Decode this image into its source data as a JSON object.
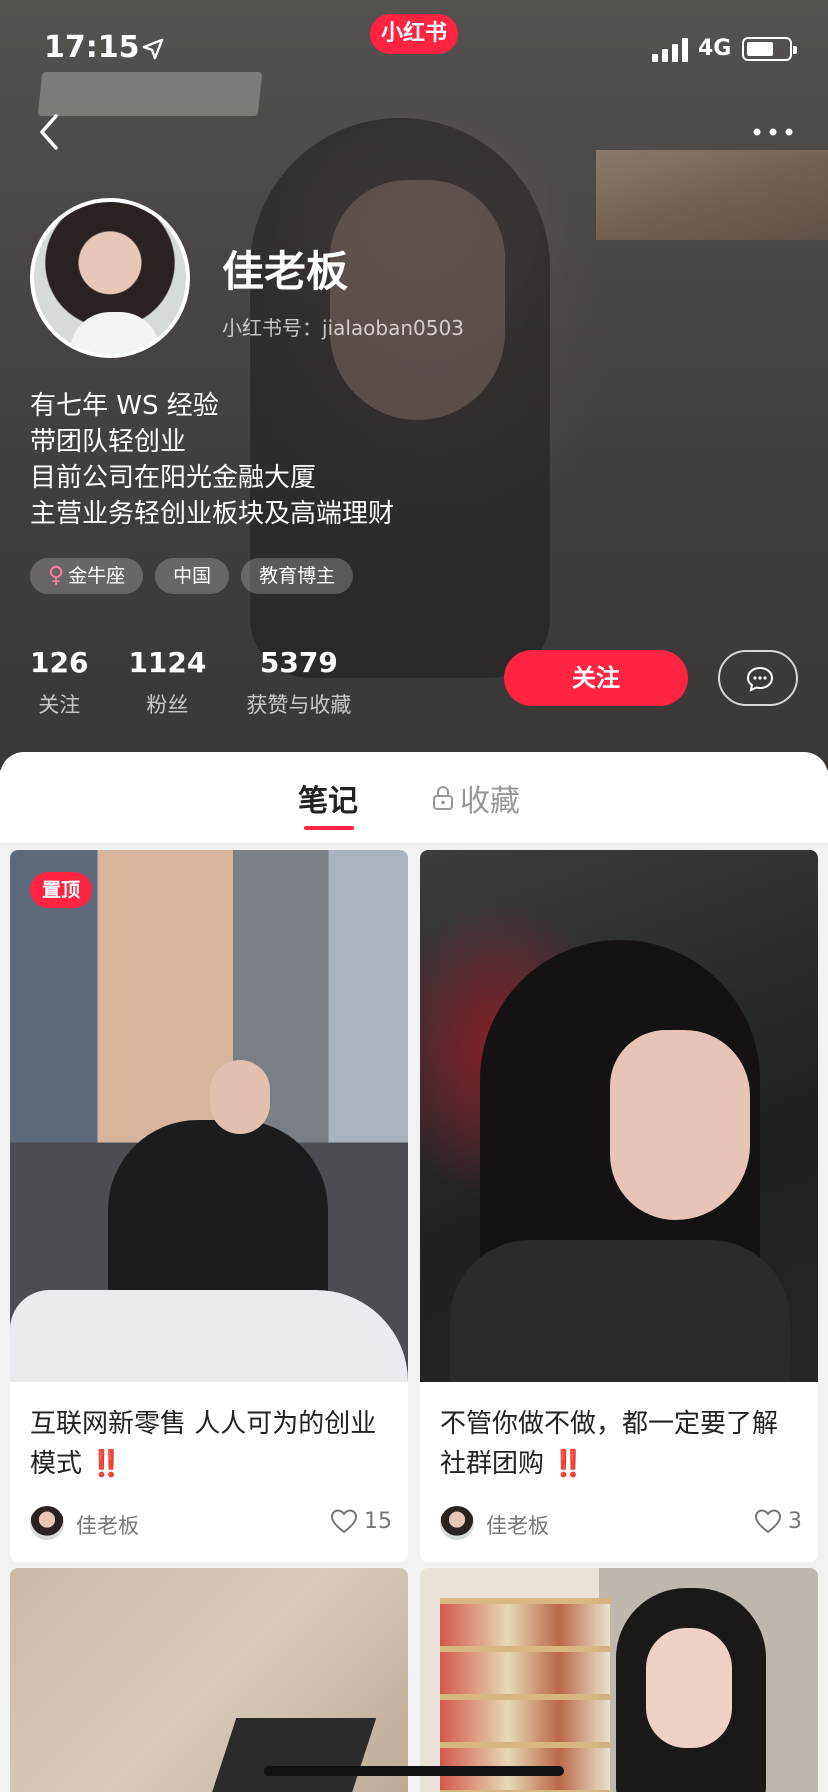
{
  "status_bar": {
    "time": "17:15",
    "network": "4G"
  },
  "app": {
    "logo_text": "小红书"
  },
  "profile": {
    "nickname": "佳老板",
    "user_id_label": "小红书号：jialaoban0503",
    "bio": [
      "有七年 WS 经验",
      "带团队轻创业",
      "目前公司在阳光金融大厦",
      "主营业务轻创业板块及高端理财"
    ],
    "tags": [
      {
        "label": "金牛座",
        "icon": "female-icon"
      },
      {
        "label": "中国"
      },
      {
        "label": "教育博主"
      }
    ],
    "stats": [
      {
        "value": "126",
        "label": "关注"
      },
      {
        "value": "1124",
        "label": "粉丝"
      },
      {
        "value": "5379",
        "label": "获赞与收藏"
      }
    ],
    "follow_label": "关注"
  },
  "tabs": {
    "notes": "笔记",
    "collect": "收藏"
  },
  "notes": [
    {
      "pinned_label": "置顶",
      "title": "互联网新零售 人人可为的创业模式",
      "bang": "‼️",
      "author": "佳老板",
      "likes": "15"
    },
    {
      "title": "不管你做不做，都一定要了解社群团购",
      "bang": "‼️",
      "author": "佳老板",
      "likes": "3"
    }
  ],
  "colors": {
    "accent": "#ff2442"
  }
}
